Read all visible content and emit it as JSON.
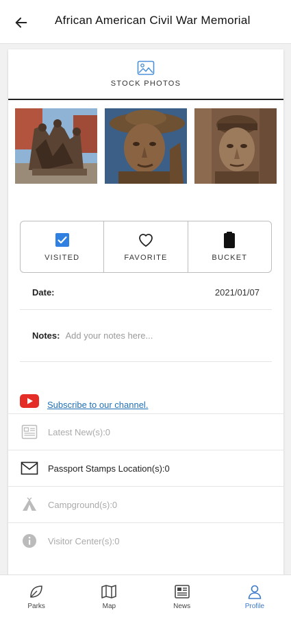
{
  "header": {
    "title": "African American Civil War Memorial",
    "back_icon": "arrow-left-icon"
  },
  "photos": {
    "tab_label": "STOCK PHOTOS",
    "tab_icon": "image-icon",
    "thumbnails": [
      {
        "name": "memorial-statue-group-photo"
      },
      {
        "name": "soldier-face-sculpture-photo"
      },
      {
        "name": "soldier-relief-sculpture-photo"
      }
    ]
  },
  "status": {
    "visited_label": "VISITED",
    "favorite_label": "FAVORITE",
    "bucket_label": "BUCKET",
    "visited_checked": true
  },
  "details": {
    "date_label": "Date:",
    "date_value": "2021/01/07",
    "notes_label": "Notes:",
    "notes_placeholder": "Add your notes here..."
  },
  "youtube": {
    "link_text": "Subscribe to our channel."
  },
  "info": {
    "latest_news": "Latest New(s):0",
    "passport_stamps": "Passport Stamps Location(s):0",
    "campground": "Campground(s):0",
    "visitor_center": "Visitor Center(s):0"
  },
  "nav": {
    "parks": "Parks",
    "map": "Map",
    "news": "News",
    "profile": "Profile",
    "active": "Profile"
  },
  "colors": {
    "accent": "#3a78c9",
    "link": "#1e6fb5",
    "youtube_red": "#e52d27",
    "checkbox_blue": "#2f80e0"
  }
}
